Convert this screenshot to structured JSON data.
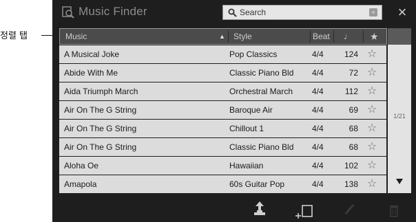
{
  "callout": {
    "label": "정렬 탭"
  },
  "app": {
    "title": "Music Finder",
    "icon": "music-finder-icon"
  },
  "search": {
    "placeholder": "Search",
    "value": ""
  },
  "columns": {
    "music": "Music",
    "style": "Style",
    "beat": "Beat",
    "tempo_icon": "♩",
    "favorite_icon": "★",
    "sort": "ascending"
  },
  "rows": [
    {
      "music": "A Musical Joke",
      "style": "Pop Classics",
      "beat": "4/4",
      "tempo": "124",
      "fav": "☆"
    },
    {
      "music": "Abide With Me",
      "style": "Classic Piano Bld",
      "beat": "4/4",
      "tempo": "72",
      "fav": "☆"
    },
    {
      "music": "Aida Triumph March",
      "style": "Orchestral March",
      "beat": "4/4",
      "tempo": "112",
      "fav": "☆"
    },
    {
      "music": "Air On The G String",
      "style": "Baroque Air",
      "beat": "4/4",
      "tempo": "69",
      "fav": "☆"
    },
    {
      "music": "Air On The G String",
      "style": "Chillout 1",
      "beat": "4/4",
      "tempo": "68",
      "fav": "☆"
    },
    {
      "music": "Air On The G String",
      "style": "Classic Piano Bld",
      "beat": "4/4",
      "tempo": "68",
      "fav": "☆"
    },
    {
      "music": "Aloha Oe",
      "style": "Hawaiian",
      "beat": "4/4",
      "tempo": "102",
      "fav": "☆"
    },
    {
      "music": "Amapola",
      "style": "60s Guitar Pop",
      "beat": "4/4",
      "tempo": "138",
      "fav": "☆"
    }
  ],
  "pagination": {
    "indicator": "1/21"
  },
  "close_label": "×",
  "clear_label": "×",
  "bottom": [
    "load-icon",
    "add-record-icon",
    "edit-icon",
    "delete-icon"
  ],
  "colors": {
    "screen_bg": "#1e1e1e",
    "row_bg": "#dcdcdc",
    "header_bg": "#4b4b4b",
    "search_bg": "#e6e6e6"
  }
}
